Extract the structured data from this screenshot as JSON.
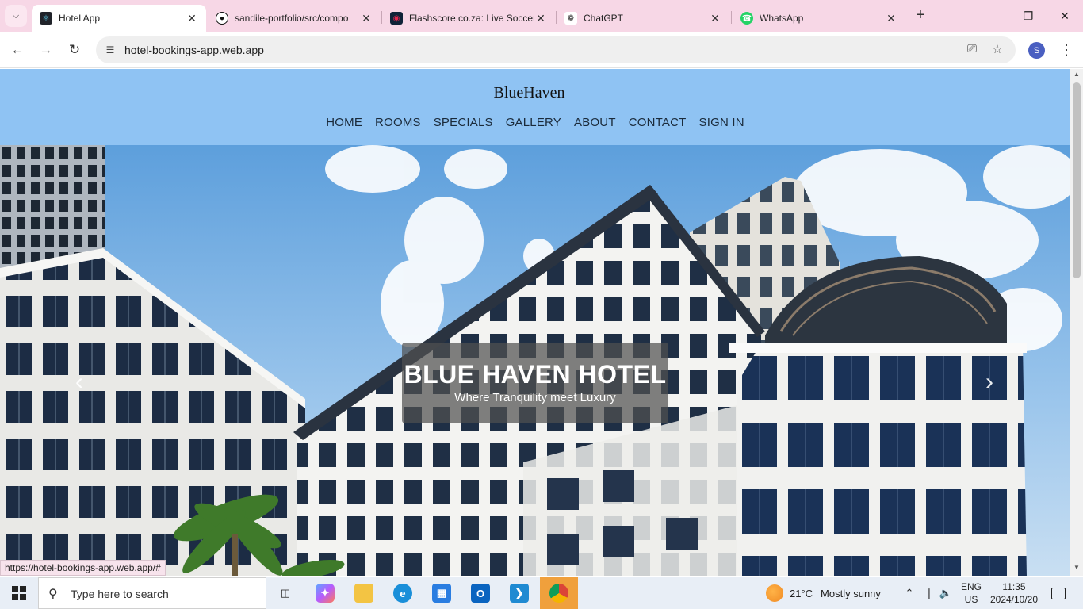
{
  "browser": {
    "tab_search_icon": "chevron-down-icon",
    "tabs": [
      {
        "title": "Hotel App",
        "icon": "react-icon",
        "active": true
      },
      {
        "title": "sandile-portfolio/src/compo",
        "icon": "github-icon",
        "active": false
      },
      {
        "title": "Flashscore.co.za: Live Soccer",
        "icon": "flashscore-icon",
        "active": false
      },
      {
        "title": "ChatGPT",
        "icon": "chatgpt-icon",
        "active": false
      },
      {
        "title": "WhatsApp",
        "icon": "whatsapp-icon",
        "active": false
      }
    ],
    "url": "hotel-bookings-app.web.app",
    "profile_initial": "S",
    "status_url": "https://hotel-bookings-app.web.app/#"
  },
  "site": {
    "brand": "BlueHaven",
    "nav": [
      "HOME",
      "ROOMS",
      "SPECIALS",
      "GALLERY",
      "ABOUT",
      "CONTACT",
      "SIGN IN"
    ],
    "header_color": "#8fc3f3",
    "hero": {
      "title": "BLUE HAVEN HOTEL",
      "subtitle": "Where Tranquility meet Luxury"
    }
  },
  "taskbar": {
    "search_placeholder": "Type here to search",
    "apps": [
      "task-view",
      "copilot",
      "file-explorer",
      "edge",
      "microsoft-store",
      "outlook",
      "vscode",
      "chrome"
    ],
    "weather_temp": "21°C",
    "weather_text": "Mostly sunny",
    "lang_top": "ENG",
    "lang_bottom": "US",
    "time": "11:35",
    "date": "2024/10/20"
  }
}
